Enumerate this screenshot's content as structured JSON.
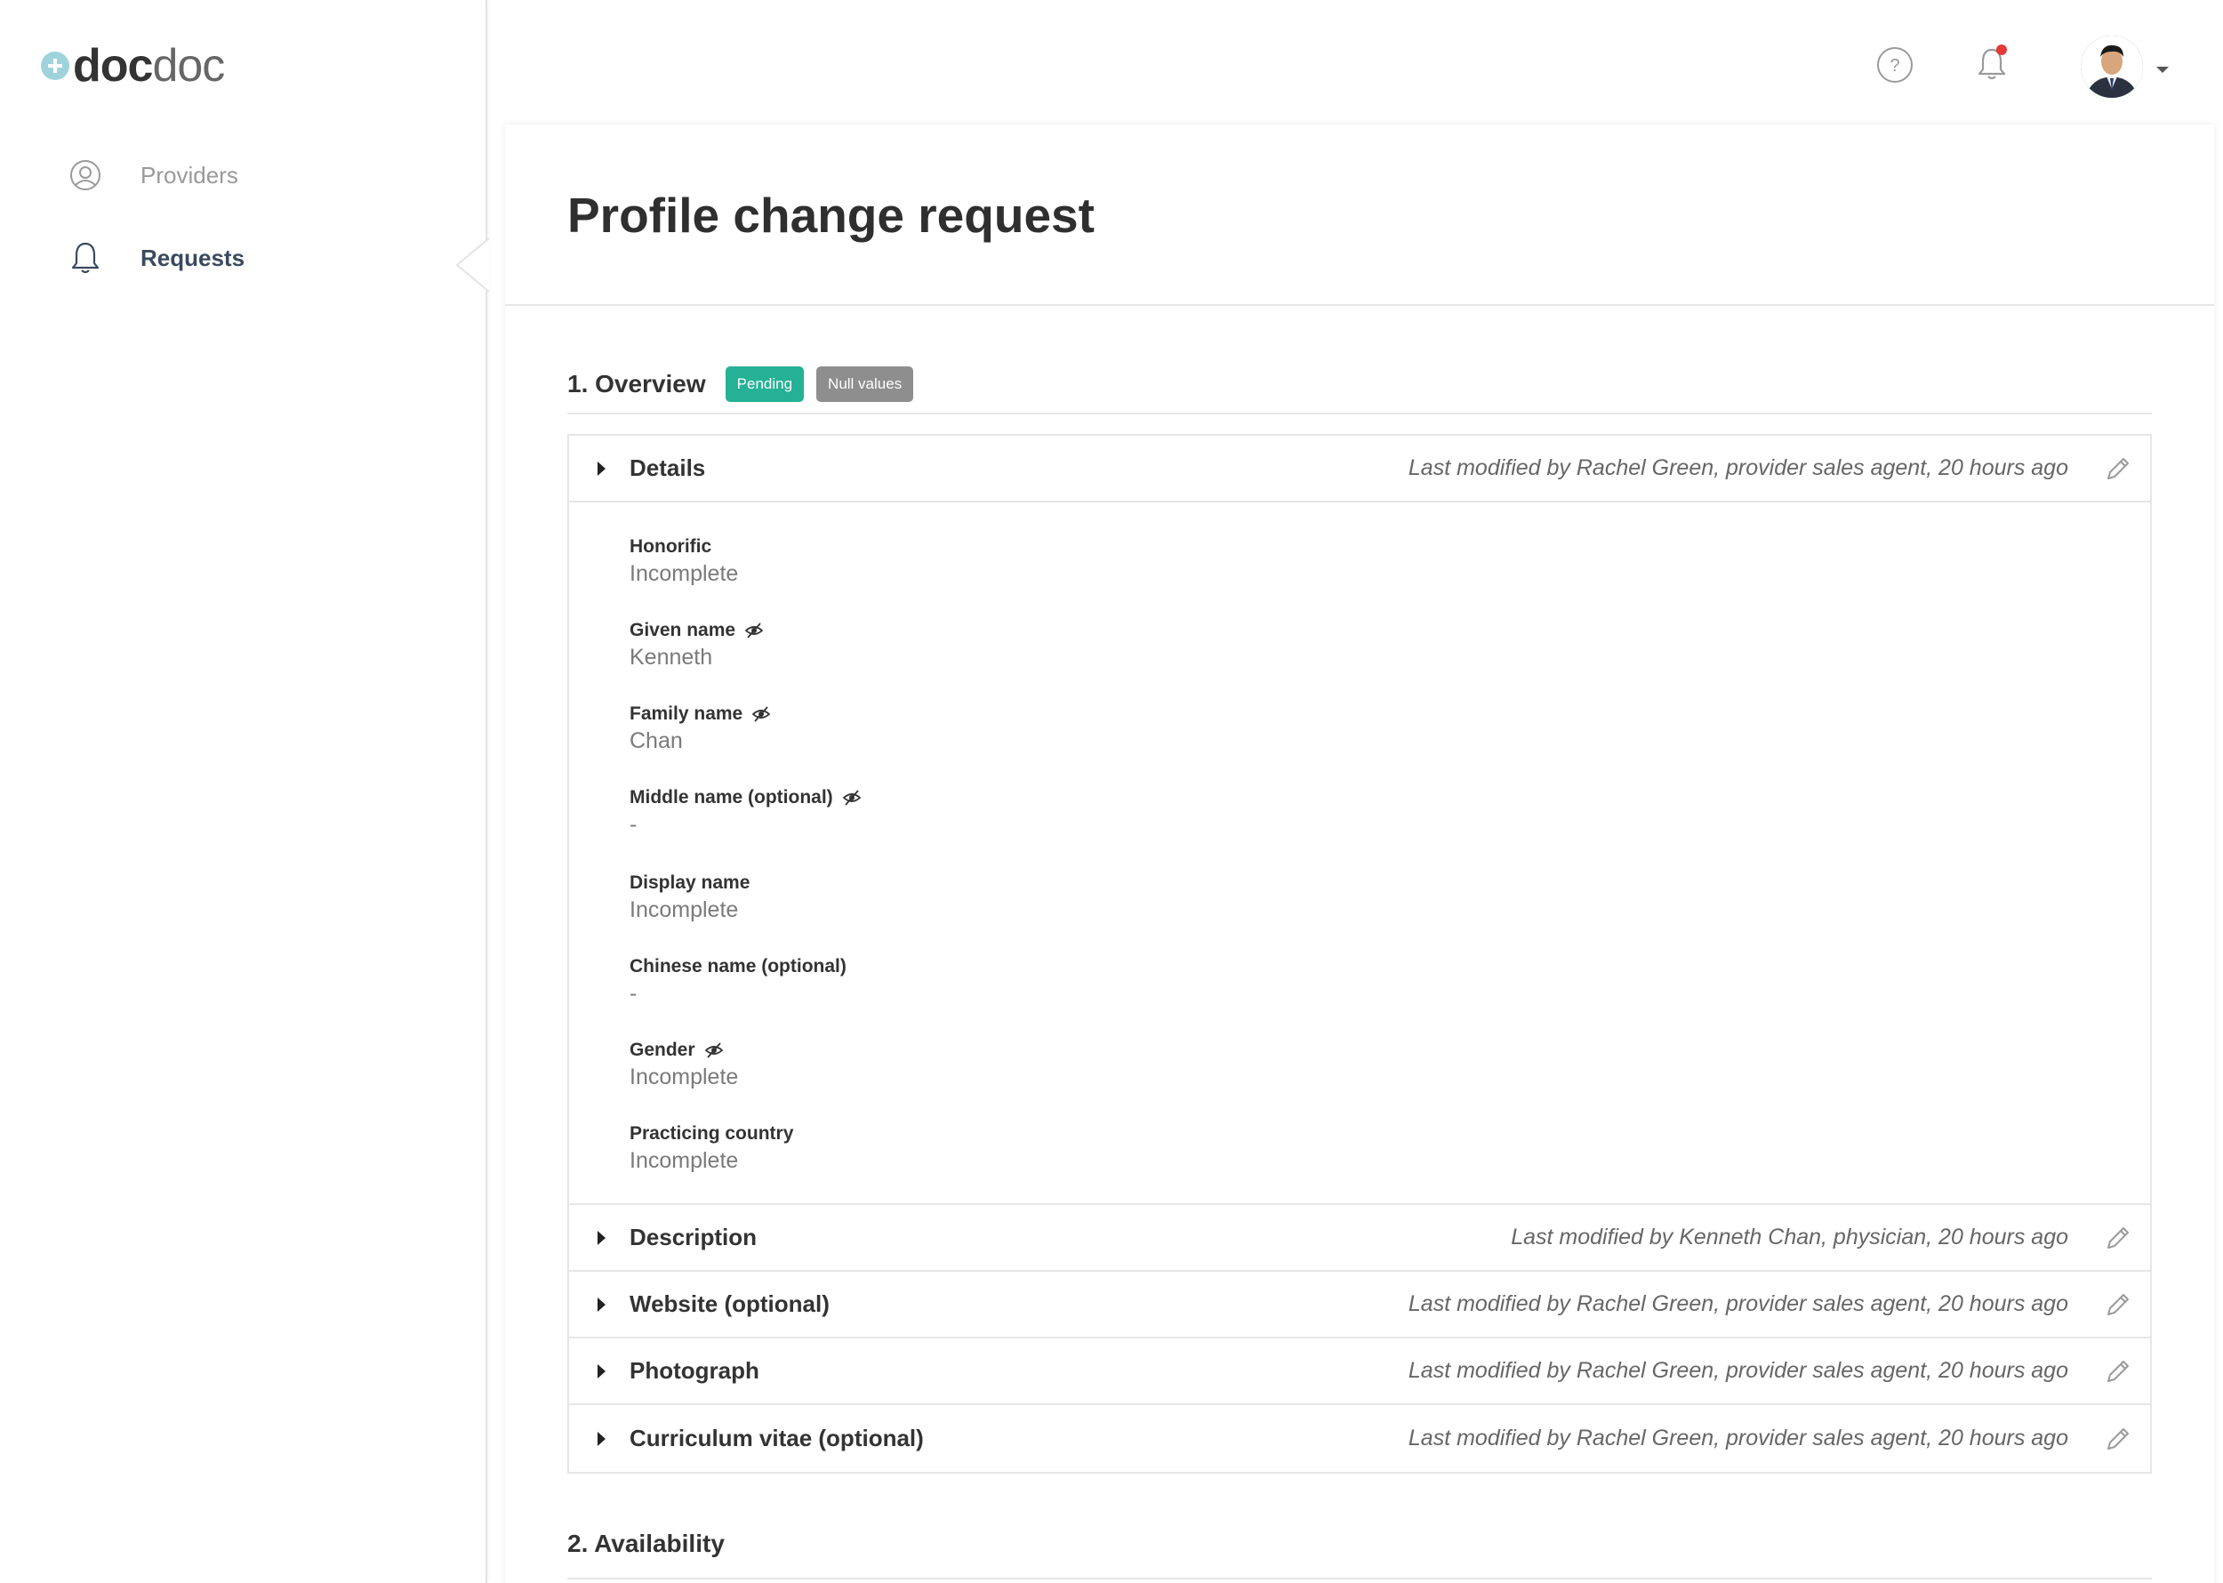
{
  "brand": {
    "logo_bold": "doc",
    "logo_light": "doc"
  },
  "sidebar": {
    "items": [
      {
        "label": "Providers",
        "icon": "user-circle-icon"
      },
      {
        "label": "Requests",
        "icon": "bell-icon"
      }
    ]
  },
  "header": {
    "help_icon": "help-icon",
    "notifications_icon": "bell-icon"
  },
  "page": {
    "title": "Profile change request"
  },
  "overview": {
    "title": "1. Overview",
    "badges": [
      "Pending",
      "Null values"
    ],
    "details": {
      "title": "Details",
      "meta": "Last modified by Rachel Green, provider sales agent, 20 hours ago",
      "fields": [
        {
          "label": "Honorific",
          "value": "Incomplete"
        },
        {
          "label": "Given name",
          "value": "Kenneth"
        },
        {
          "label": "Family name",
          "value": "Chan"
        },
        {
          "label": "Middle name (optional)",
          "value": "-"
        },
        {
          "label": "Display name",
          "value": "Incomplete"
        },
        {
          "label": "Chinese name (optional)",
          "value": "-"
        },
        {
          "label": "Gender",
          "value": "Incomplete"
        },
        {
          "label": "Practicing country",
          "value": "Incomplete"
        }
      ]
    },
    "rows": [
      {
        "title": "Description",
        "meta": "Last modified by Kenneth Chan, physician, 20 hours ago"
      },
      {
        "title": "Website (optional)",
        "meta": "Last modified by Rachel Green, provider sales agent, 20 hours ago"
      },
      {
        "title": "Photograph",
        "meta": "Last modified by Rachel Green, provider sales agent, 20 hours ago"
      },
      {
        "title": "Curriculum vitae (optional)",
        "meta": "Last modified by Rachel Green, provider sales agent, 20 hours ago"
      }
    ]
  },
  "availability": {
    "title": "2. Availability"
  },
  "colors": {
    "pending": "#25b196",
    "null_values": "#8e8e8e",
    "notification_dot": "#e53935",
    "logo_accent": "#9ed3dc"
  }
}
